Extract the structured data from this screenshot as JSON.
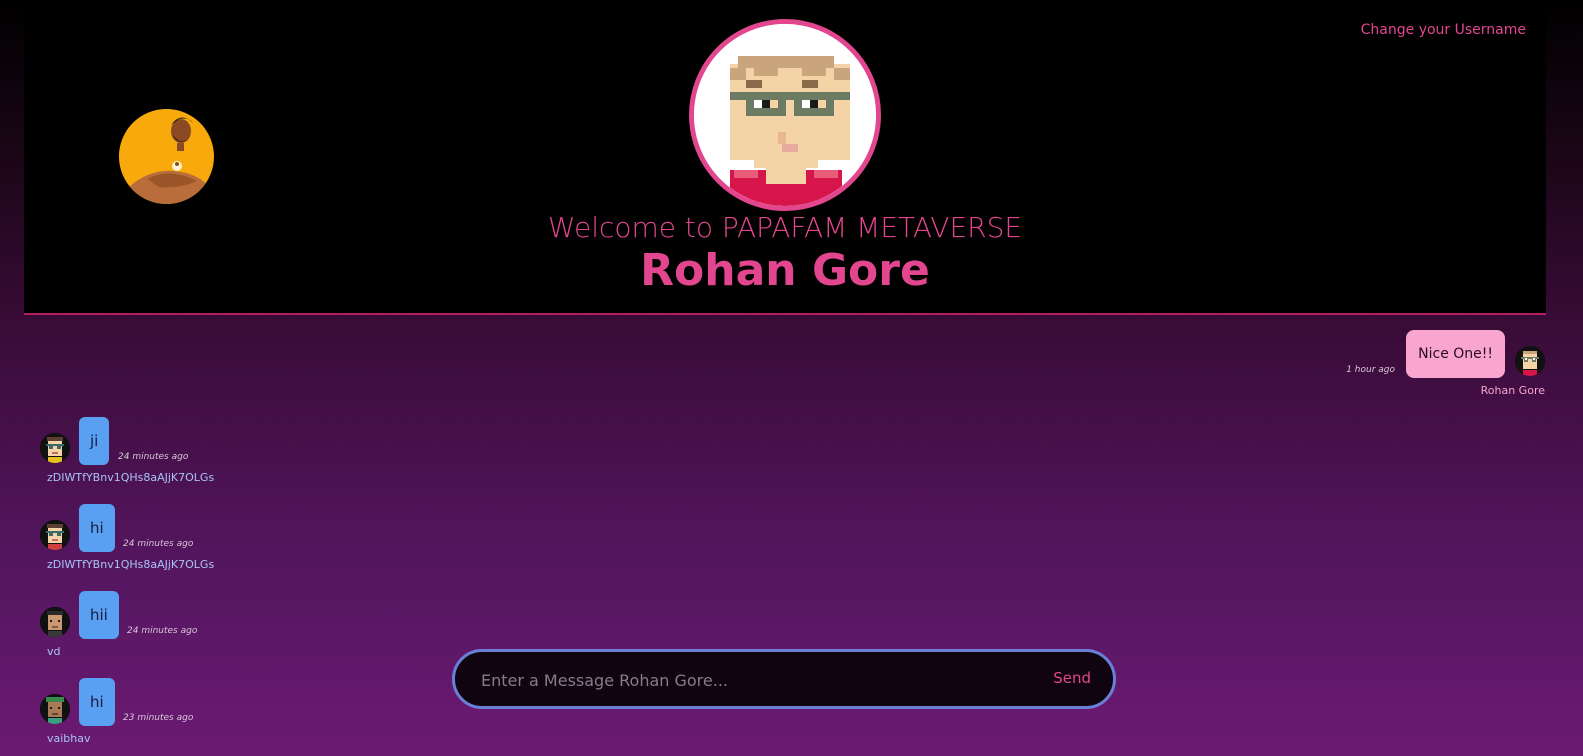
{
  "header": {
    "change_username_label": "Change your Username",
    "welcome_text": "Welcome to PAPAFAM METAVERSE",
    "user_name": "Rohan Gore"
  },
  "colors": {
    "accent": "#e2468f",
    "bubble_own": "#f8a5d0",
    "bubble_other": "#5aa0f2",
    "input_border": "#6a80d6"
  },
  "messages": [
    {
      "text": "Nice One!!",
      "time": "1 hour ago",
      "sender": "Rohan Gore",
      "own": true
    },
    {
      "text": "ji",
      "time": "24 minutes ago",
      "sender": "zDIWTfYBnv1QHs8aAJjK7OLGs",
      "own": false
    },
    {
      "text": "hi",
      "time": "24 minutes ago",
      "sender": "zDIWTfYBnv1QHs8aAJjK7OLGs",
      "own": false
    },
    {
      "text": "hii",
      "time": "24 minutes ago",
      "sender": "vd",
      "own": false
    },
    {
      "text": "hi",
      "time": "23 minutes ago",
      "sender": "vaibhav",
      "own": false
    }
  ],
  "composer": {
    "placeholder": "Enter a Message Rohan Gore...",
    "send_label": "Send"
  }
}
